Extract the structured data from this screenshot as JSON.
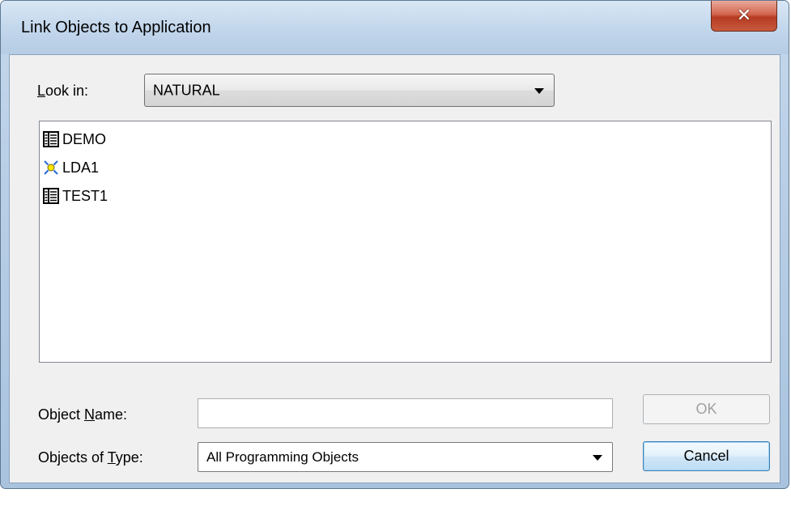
{
  "window": {
    "title": "Link Objects to Application"
  },
  "look_in": {
    "label": "Look in:",
    "value": "NATURAL"
  },
  "objects": [
    {
      "name": "DEMO",
      "icon": "program-icon"
    },
    {
      "name": "LDA1",
      "icon": "data-area-icon"
    },
    {
      "name": "TEST1",
      "icon": "program-icon"
    }
  ],
  "object_name": {
    "label": "Object Name:",
    "value": "",
    "placeholder": ""
  },
  "objects_of_type": {
    "label": "Objects of Type:",
    "value": "All Programming Objects"
  },
  "buttons": {
    "ok": "OK",
    "cancel": "Cancel"
  },
  "colors": {
    "accent": "#3c7fb1",
    "close": "#c8452a",
    "frame": "#b9cfe6"
  }
}
